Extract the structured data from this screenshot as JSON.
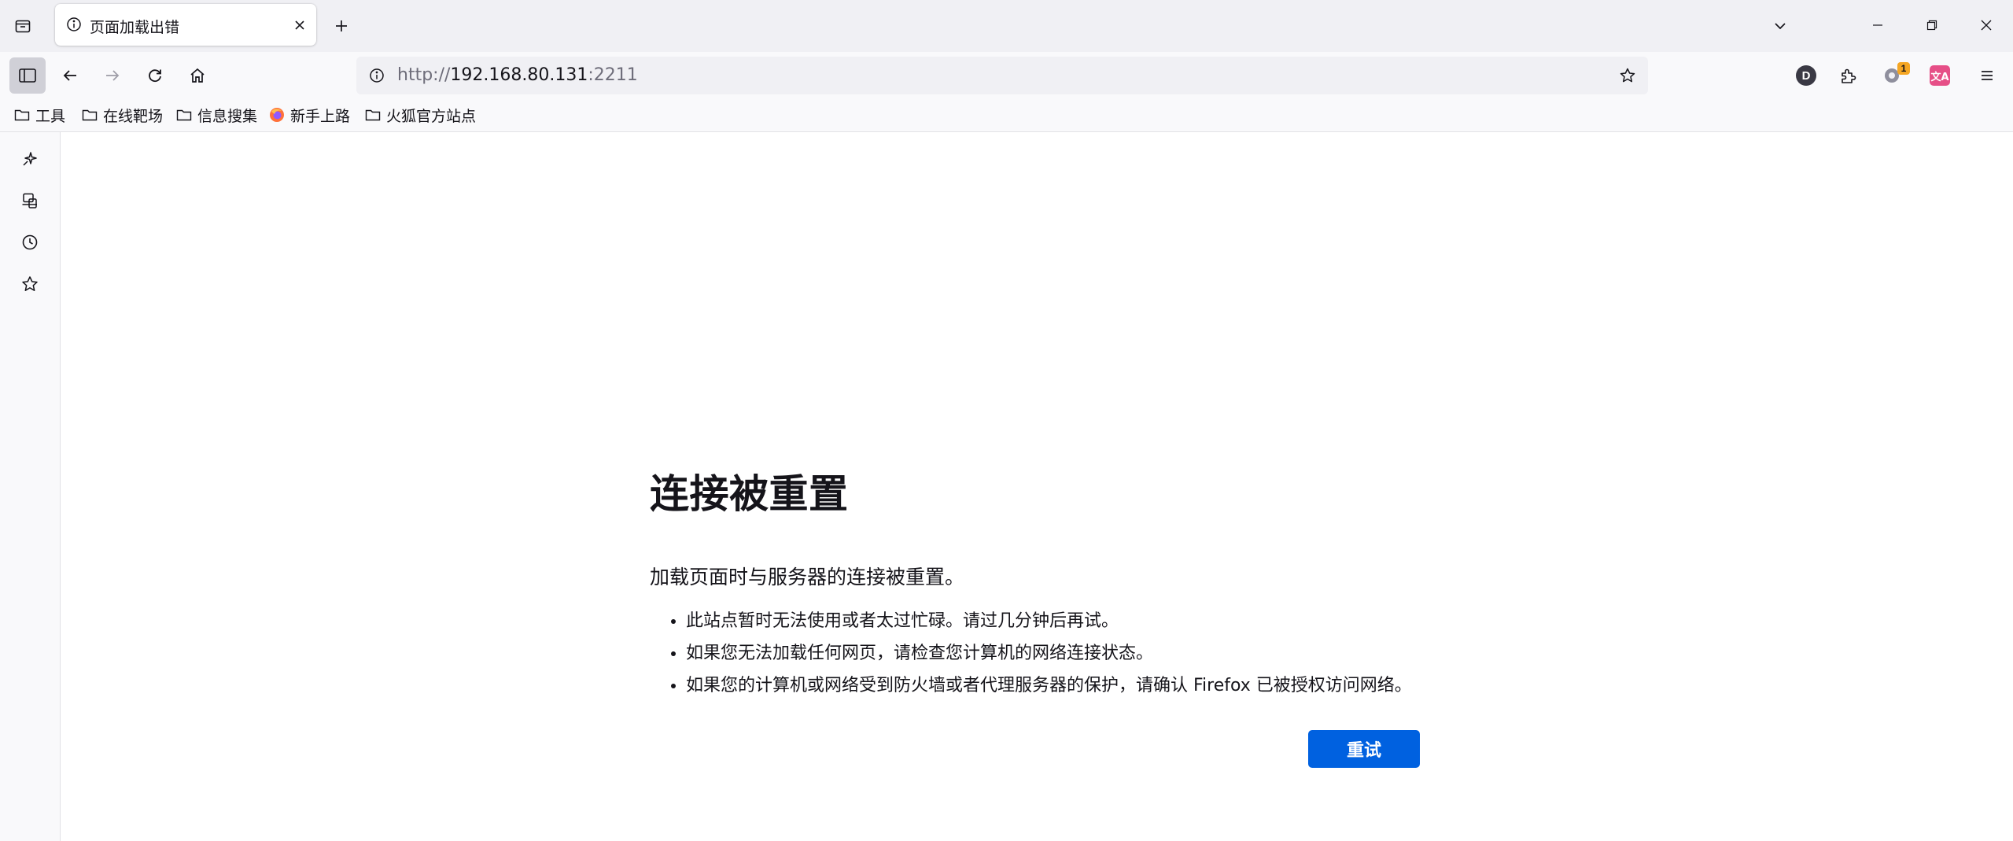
{
  "tab": {
    "title": "页面加载出错",
    "icon": "info-icon"
  },
  "urlbar": {
    "scheme": "http://",
    "host": "192.168.80.131",
    "port": ":2211"
  },
  "toolbar": {
    "profile_initial": "D",
    "notification_badge": "1",
    "translate_label": "文A"
  },
  "bookmarks": [
    {
      "label": "工具",
      "icon": "folder-icon"
    },
    {
      "label": "在线靶场",
      "icon": "folder-icon"
    },
    {
      "label": "信息搜集",
      "icon": "folder-icon"
    },
    {
      "label": "新手上路",
      "icon": "firefox-icon"
    },
    {
      "label": "火狐官方站点",
      "icon": "folder-icon"
    }
  ],
  "sidebar": [
    "ai-chat-icon",
    "synced-tabs-icon",
    "history-icon",
    "bookmarks-star-icon"
  ],
  "error_page": {
    "title": "连接被重置",
    "description": "加载页面时与服务器的连接被重置。",
    "suggestions": [
      "此站点暂时无法使用或者太过忙碌。请过几分钟后再试。",
      "如果您无法加载任何网页，请检查您计算机的网络连接状态。",
      "如果您的计算机或网络受到防火墙或者代理服务器的保护，请确认 Firefox 已被授权访问网络。"
    ],
    "retry_label": "重试"
  },
  "colors": {
    "accent": "#0061e0",
    "chrome_bg": "#f0f0f4",
    "content_bg": "#ffffff"
  }
}
